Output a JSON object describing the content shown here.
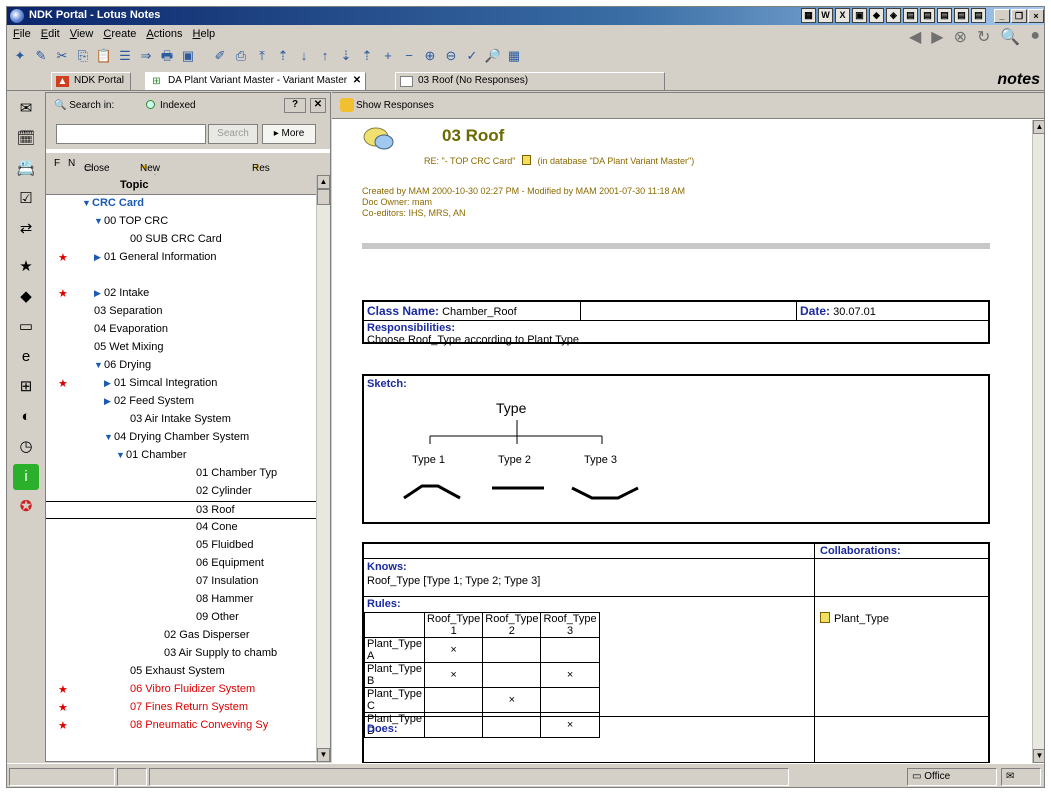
{
  "window": {
    "title": "NDK Portal - Lotus Notes",
    "window_buttons": [
      "_",
      "❐",
      "×"
    ]
  },
  "menu": [
    "File",
    "Edit",
    "View",
    "Create",
    "Actions",
    "Help"
  ],
  "tabs": [
    {
      "label": "NDK Portal",
      "icon": "portal-icon"
    },
    {
      "label": "DA Plant Variant Master - Variant Master",
      "icon": "database-icon"
    },
    {
      "label": "03 Roof (No Responses)",
      "icon": "document-icon"
    }
  ],
  "brand": "notes",
  "search": {
    "label": "Search in:",
    "indexed": "Indexed",
    "help": "?",
    "input_value": "",
    "button": "Search",
    "more": "More"
  },
  "view_actions": {
    "f": "F",
    "n": "N",
    "close": "Close",
    "new_main_topic": "New Main Topic",
    "response": "Res"
  },
  "view": {
    "column": "Topic",
    "rows": [
      {
        "text": "CRC Card",
        "level": 0,
        "twisty": "open",
        "type": "category",
        "star": false
      },
      {
        "text": "00 TOP CRC",
        "level": 1,
        "twisty": "open",
        "star": false
      },
      {
        "text": "00 SUB CRC Card",
        "level": 2,
        "twisty": "none",
        "star": false
      },
      {
        "text": "01 General Information",
        "level": 1,
        "twisty": "closed",
        "star": true
      },
      {
        "text": "",
        "level": 1,
        "twisty": "none",
        "star": false
      },
      {
        "text": "02 Intake",
        "level": 1,
        "twisty": "closed",
        "star": true
      },
      {
        "text": "03 Separation",
        "level": 1,
        "twisty": "none",
        "star": false
      },
      {
        "text": "04 Evaporation",
        "level": 1,
        "twisty": "none",
        "star": false
      },
      {
        "text": "05 Wet Mixing",
        "level": 1,
        "twisty": "none",
        "star": false
      },
      {
        "text": "06 Drying",
        "level": 1,
        "twisty": "open",
        "star": false
      },
      {
        "text": "01 Simcal Integration",
        "level": 2,
        "twisty": "closed",
        "star": true
      },
      {
        "text": "02 Feed System",
        "level": 2,
        "twisty": "closed",
        "star": false
      },
      {
        "text": "03 Air Intake System",
        "level": 2,
        "twisty": "none",
        "star": false
      },
      {
        "text": "04 Drying Chamber System",
        "level": 2,
        "twisty": "open",
        "star": false
      },
      {
        "text": "01 Chamber",
        "level": 3,
        "twisty": "open",
        "star": false
      },
      {
        "text": "01 Chamber Typ",
        "level": 4,
        "twisty": "none",
        "star": false
      },
      {
        "text": "02 Cylinder",
        "level": 4,
        "twisty": "none",
        "star": false
      },
      {
        "text": "03 Roof",
        "level": 4,
        "twisty": "none",
        "star": false,
        "selected": true
      },
      {
        "text": "04 Cone",
        "level": 4,
        "twisty": "none",
        "star": false
      },
      {
        "text": "05 Fluidbed",
        "level": 4,
        "twisty": "none",
        "star": false
      },
      {
        "text": "06 Equipment",
        "level": 4,
        "twisty": "none",
        "star": false
      },
      {
        "text": "07 Insulation",
        "level": 4,
        "twisty": "none",
        "star": false
      },
      {
        "text": "08 Hammer",
        "level": 4,
        "twisty": "none",
        "star": false
      },
      {
        "text": "09 Other",
        "level": 4,
        "twisty": "none",
        "star": false
      },
      {
        "text": "02 Gas Disperser",
        "level": 3,
        "twisty": "none",
        "star": false
      },
      {
        "text": "03 Air Supply to chamb",
        "level": 3,
        "twisty": "none",
        "star": false
      },
      {
        "text": "05 Exhaust System",
        "level": 2,
        "twisty": "none",
        "star": false
      },
      {
        "text": "06 Vibro Fluidizer System",
        "level": 2,
        "twisty": "none",
        "star": true,
        "red": true
      },
      {
        "text": "07 Fines Return System",
        "level": 2,
        "twisty": "none",
        "star": true,
        "red": true
      },
      {
        "text": "08 Pneumatic Conveving Sy",
        "level": 2,
        "twisty": "none",
        "star": true,
        "red": true
      }
    ]
  },
  "doc_actions": {
    "show_responses": "Show Responses"
  },
  "document": {
    "title": "03 Roof",
    "re_prefix": "RE: \"- TOP CRC Card\"",
    "re_suffix": "(in database \"DA Plant Variant Master\")",
    "created": "Created by MAM 2000-10-30 02:27 PM  -  Modified by MAM 2001-07-30 11:18 AM",
    "owner": "Doc Owner: mam",
    "coeditors": "Co-editors: IHS, MRS, AN"
  },
  "card": {
    "class_name_label": "Class Name:",
    "class_name": "Chamber_Roof",
    "date_label": "Date:",
    "date": "30.07.01",
    "responsibilities_label": "Responsibilities:",
    "responsibilities": "Choose Roof_Type according to Plant Type",
    "sketch_label": "Sketch:",
    "sketch_root": "Type",
    "sketch_types": [
      "Type 1",
      "Type 2",
      "Type 3"
    ],
    "collaborations_label": "Collaborations:",
    "collaborator": "Plant_Type",
    "knows_label": "Knows:",
    "knows": "Roof_Type [Type 1; Type 2; Type 3]",
    "rules_label": "Rules:",
    "rules_header": [
      "",
      "Roof_Type 1",
      "Roof_Type 2",
      "Roof_Type 3"
    ],
    "rules_rows": [
      {
        "label": "Plant_Type A",
        "cells": [
          "×",
          "",
          ""
        ]
      },
      {
        "label": "Plant_Type B",
        "cells": [
          "×",
          "",
          "×"
        ]
      },
      {
        "label": "Plant_Type C",
        "cells": [
          "",
          "×",
          ""
        ]
      },
      {
        "label": "Plant_Type D",
        "cells": [
          "",
          "",
          "×"
        ]
      }
    ],
    "does_label": "Does:"
  },
  "status": {
    "location": "Office"
  }
}
